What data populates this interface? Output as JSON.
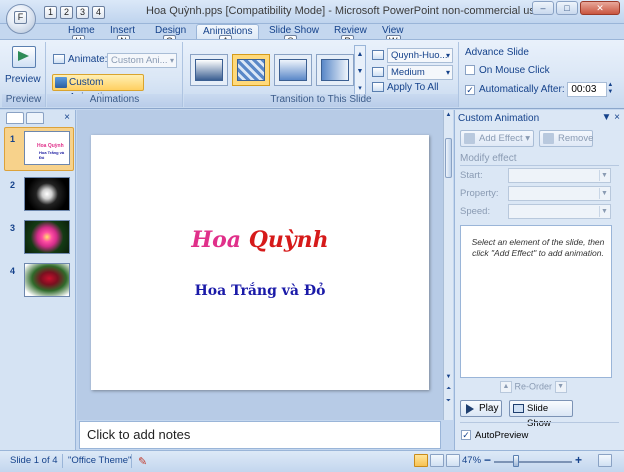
{
  "window": {
    "title": "Hoa Quỳnh.pps [Compatibility Mode] - Microsoft PowerPoint non-commercial use",
    "minimize": "–",
    "maximize": "□",
    "close": "✕"
  },
  "office_button": {
    "keytip": "F"
  },
  "quick_access": {
    "keytips": [
      "1",
      "2",
      "3",
      "4"
    ]
  },
  "tabs": [
    {
      "label": "Home",
      "keytip": "H"
    },
    {
      "label": "Insert",
      "keytip": "N"
    },
    {
      "label": "Design",
      "keytip": "G"
    },
    {
      "label": "Animations",
      "keytip": "A",
      "active": true
    },
    {
      "label": "Slide Show",
      "keytip": "S"
    },
    {
      "label": "Review",
      "keytip": "R"
    },
    {
      "label": "View",
      "keytip": "W"
    }
  ],
  "ribbon": {
    "preview_group": {
      "button": "Preview",
      "label": "Preview"
    },
    "animations_group": {
      "animate_label": "Animate:",
      "animate_value": "Custom Ani...",
      "custom_animation": "Custom Animation",
      "label": "Animations"
    },
    "transition_group": {
      "label": "Transition to This Slide",
      "sound_value": "Quynh-Huo...",
      "speed_value": "Medium",
      "apply_all": "Apply To All"
    },
    "advance_group": {
      "title": "Advance Slide",
      "on_click": "On Mouse Click",
      "on_click_checked": false,
      "auto_after": "Automatically After:",
      "auto_after_checked": true,
      "time": "00:03"
    }
  },
  "slides_panel": {
    "slides": [
      {
        "number": "1",
        "thumb_title": "Hoa Quỳnh",
        "thumb_subtitle": "Hoa Trắng và Đỏ",
        "active": true
      },
      {
        "number": "2"
      },
      {
        "number": "3"
      },
      {
        "number": "4"
      }
    ],
    "close": "×"
  },
  "slide": {
    "title_part1": "Hoa ",
    "title_part2": "Quỳnh",
    "subtitle": "Hoa Trắng và Đỏ"
  },
  "notes": {
    "placeholder": "Click to add notes"
  },
  "task_pane": {
    "title": "Custom Animation",
    "controls": "▼ ×",
    "add_effect": "Add Effect ▾",
    "remove": "Remove",
    "modify_effect": "Modify effect",
    "start_label": "Start:",
    "property_label": "Property:",
    "speed_label": "Speed:",
    "hint": "Select an element of the slide, then click \"Add Effect\" to add animation.",
    "reorder": "Re-Order",
    "play": "Play",
    "slide_show": "Slide Show",
    "autopreview": "AutoPreview",
    "autopreview_checked": true
  },
  "status_bar": {
    "slide_info": "Slide 1 of 4",
    "theme": "\"Office Theme\"",
    "zoom": "47%",
    "zoom_out": "−",
    "zoom_in": "+"
  }
}
